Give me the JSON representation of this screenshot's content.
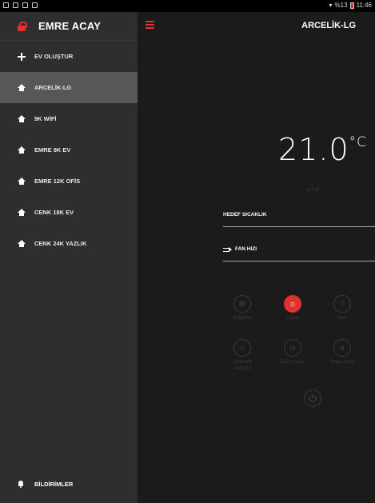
{
  "statusbar": {
    "signal": "%13",
    "time": "11:46"
  },
  "sidebar": {
    "user_name": "EMRE ACAY",
    "items": [
      {
        "label": "EV OLUŞTUR",
        "icon": "plus-icon"
      },
      {
        "label": "ARCELİK-LG",
        "icon": "home-icon",
        "active": true
      },
      {
        "label": "9K WİFİ",
        "icon": "home-icon"
      },
      {
        "label": "EMRE 9K EV",
        "icon": "home-icon"
      },
      {
        "label": "EMRE 12K OFİS",
        "icon": "home-icon"
      },
      {
        "label": "CENK 18K EV",
        "icon": "home-icon"
      },
      {
        "label": "CENK 24K YAZLIK",
        "icon": "home-icon"
      }
    ],
    "notifications_label": "BİLDİRİMLER"
  },
  "main": {
    "title": "ARCELİK-LG",
    "temperature": "21.0",
    "temperature_unit": "°C",
    "sub_temperature": "7.8°",
    "target_temp_label": "HEDEF SICAKLIK",
    "fan_label": "FAN HIZI",
    "modes": [
      {
        "label": "Soğutma",
        "icon": "snowflake-icon"
      },
      {
        "label": "Isıtma",
        "icon": "sun-icon",
        "active": true
      },
      {
        "label": "Nem",
        "icon": "drop-icon"
      },
      {
        "label": "Otomatik Değişim",
        "icon": "auto-icon"
      },
      {
        "label": "Dikey Hava",
        "icon": "vertical-air-icon"
      },
      {
        "label": "Yatay Hava",
        "icon": "horizontal-air-icon"
      }
    ]
  },
  "colors": {
    "accent": "#e0312c",
    "sidebar_bg": "#2e2e2e",
    "sidebar_active": "#575757",
    "main_bg": "#1b1b1b"
  }
}
